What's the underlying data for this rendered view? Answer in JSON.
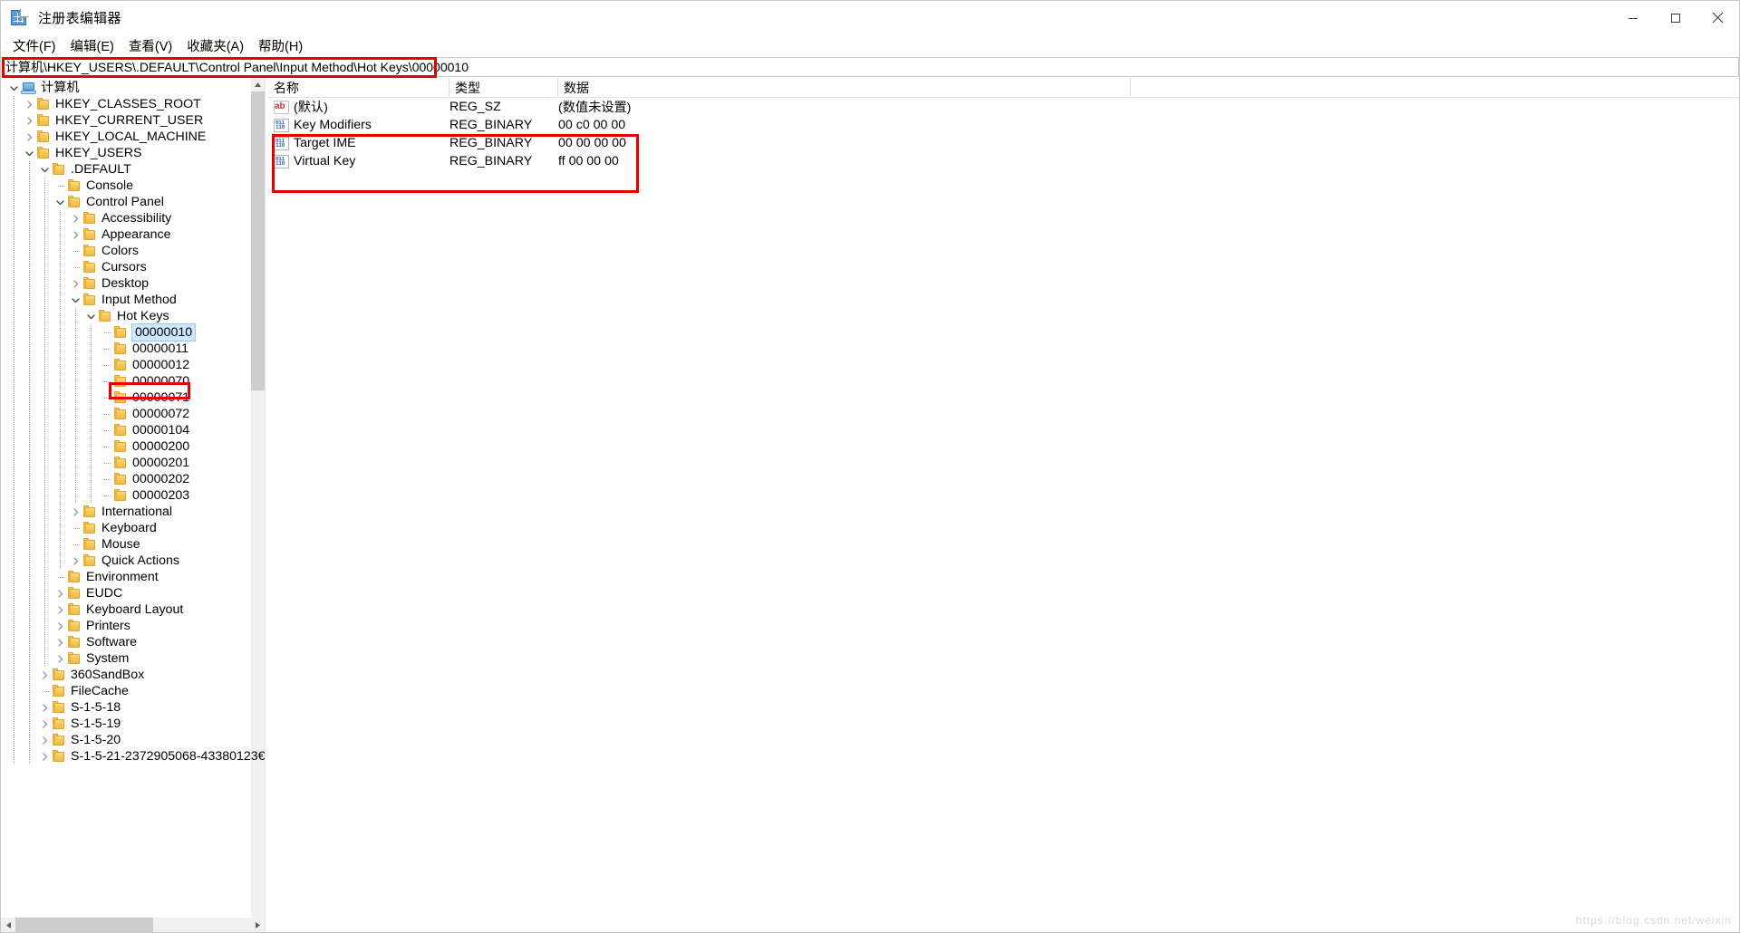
{
  "window": {
    "title": "注册表编辑器",
    "icon": "registry-editor-icon",
    "minimize_label": "最小化",
    "maximize_label": "最大化",
    "close_label": "关闭"
  },
  "menu": {
    "items": [
      {
        "label": "文件(F)",
        "name": "file"
      },
      {
        "label": "编辑(E)",
        "name": "edit"
      },
      {
        "label": "查看(V)",
        "name": "view"
      },
      {
        "label": "收藏夹(A)",
        "name": "favorites"
      },
      {
        "label": "帮助(H)",
        "name": "help"
      }
    ]
  },
  "address": {
    "value": "计算机\\HKEY_USERS\\.DEFAULT\\Control Panel\\Input Method\\Hot Keys\\00000010",
    "placeholder": ""
  },
  "tree": {
    "nodes": [
      {
        "label": "计算机",
        "depth": 0,
        "twist": "expanded",
        "icon": "computer",
        "selected": false
      },
      {
        "label": "HKEY_CLASSES_ROOT",
        "depth": 1,
        "twist": "collapsed",
        "icon": "folder",
        "selected": false
      },
      {
        "label": "HKEY_CURRENT_USER",
        "depth": 1,
        "twist": "collapsed",
        "icon": "folder",
        "selected": false
      },
      {
        "label": "HKEY_LOCAL_MACHINE",
        "depth": 1,
        "twist": "collapsed",
        "icon": "folder",
        "selected": false
      },
      {
        "label": "HKEY_USERS",
        "depth": 1,
        "twist": "expanded",
        "icon": "folder",
        "selected": false
      },
      {
        "label": ".DEFAULT",
        "depth": 2,
        "twist": "expanded",
        "icon": "folder",
        "selected": false
      },
      {
        "label": "Console",
        "depth": 3,
        "twist": "leaf",
        "icon": "folder",
        "selected": false
      },
      {
        "label": "Control Panel",
        "depth": 3,
        "twist": "expanded",
        "icon": "folder",
        "selected": false
      },
      {
        "label": "Accessibility",
        "depth": 4,
        "twist": "collapsed",
        "icon": "folder",
        "selected": false
      },
      {
        "label": "Appearance",
        "depth": 4,
        "twist": "collapsed",
        "icon": "folder",
        "selected": false
      },
      {
        "label": "Colors",
        "depth": 4,
        "twist": "leaf",
        "icon": "folder",
        "selected": false
      },
      {
        "label": "Cursors",
        "depth": 4,
        "twist": "leaf",
        "icon": "folder",
        "selected": false
      },
      {
        "label": "Desktop",
        "depth": 4,
        "twist": "collapsed",
        "icon": "folder",
        "selected": false
      },
      {
        "label": "Input Method",
        "depth": 4,
        "twist": "expanded",
        "icon": "folder",
        "selected": false
      },
      {
        "label": "Hot Keys",
        "depth": 5,
        "twist": "expanded",
        "icon": "folder",
        "selected": false
      },
      {
        "label": "00000010",
        "depth": 6,
        "twist": "leaf",
        "icon": "folder",
        "selected": true
      },
      {
        "label": "00000011",
        "depth": 6,
        "twist": "leaf",
        "icon": "folder",
        "selected": false
      },
      {
        "label": "00000012",
        "depth": 6,
        "twist": "leaf",
        "icon": "folder",
        "selected": false
      },
      {
        "label": "00000070",
        "depth": 6,
        "twist": "leaf",
        "icon": "folder",
        "selected": false
      },
      {
        "label": "00000071",
        "depth": 6,
        "twist": "leaf",
        "icon": "folder",
        "selected": false
      },
      {
        "label": "00000072",
        "depth": 6,
        "twist": "leaf",
        "icon": "folder",
        "selected": false
      },
      {
        "label": "00000104",
        "depth": 6,
        "twist": "leaf",
        "icon": "folder",
        "selected": false
      },
      {
        "label": "00000200",
        "depth": 6,
        "twist": "leaf",
        "icon": "folder",
        "selected": false
      },
      {
        "label": "00000201",
        "depth": 6,
        "twist": "leaf",
        "icon": "folder",
        "selected": false
      },
      {
        "label": "00000202",
        "depth": 6,
        "twist": "leaf",
        "icon": "folder",
        "selected": false
      },
      {
        "label": "00000203",
        "depth": 6,
        "twist": "leaf",
        "icon": "folder",
        "selected": false
      },
      {
        "label": "International",
        "depth": 4,
        "twist": "collapsed",
        "icon": "folder",
        "selected": false
      },
      {
        "label": "Keyboard",
        "depth": 4,
        "twist": "leaf",
        "icon": "folder",
        "selected": false
      },
      {
        "label": "Mouse",
        "depth": 4,
        "twist": "leaf",
        "icon": "folder",
        "selected": false
      },
      {
        "label": "Quick Actions",
        "depth": 4,
        "twist": "collapsed",
        "icon": "folder",
        "selected": false
      },
      {
        "label": "Environment",
        "depth": 3,
        "twist": "leaf",
        "icon": "folder",
        "selected": false
      },
      {
        "label": "EUDC",
        "depth": 3,
        "twist": "collapsed",
        "icon": "folder",
        "selected": false
      },
      {
        "label": "Keyboard Layout",
        "depth": 3,
        "twist": "collapsed",
        "icon": "folder",
        "selected": false
      },
      {
        "label": "Printers",
        "depth": 3,
        "twist": "collapsed",
        "icon": "folder",
        "selected": false
      },
      {
        "label": "Software",
        "depth": 3,
        "twist": "collapsed",
        "icon": "folder",
        "selected": false
      },
      {
        "label": "System",
        "depth": 3,
        "twist": "collapsed",
        "icon": "folder",
        "selected": false
      },
      {
        "label": "360SandBox",
        "depth": 2,
        "twist": "collapsed",
        "icon": "folder",
        "selected": false
      },
      {
        "label": "FileCache",
        "depth": 2,
        "twist": "leaf",
        "icon": "folder",
        "selected": false
      },
      {
        "label": "S-1-5-18",
        "depth": 2,
        "twist": "collapsed",
        "icon": "folder",
        "selected": false
      },
      {
        "label": "S-1-5-19",
        "depth": 2,
        "twist": "collapsed",
        "icon": "folder",
        "selected": false
      },
      {
        "label": "S-1-5-20",
        "depth": 2,
        "twist": "collapsed",
        "icon": "folder",
        "selected": false
      },
      {
        "label": "S-1-5-21-2372905068-43380123€",
        "depth": 2,
        "twist": "collapsed",
        "icon": "folder",
        "selected": false
      }
    ]
  },
  "list": {
    "columns": [
      "名称",
      "类型",
      "数据",
      ""
    ],
    "rows": [
      {
        "name": "(默认)",
        "type": "REG_SZ",
        "data": "(数值未设置)",
        "icon": "string-value-icon"
      },
      {
        "name": "Key Modifiers",
        "type": "REG_BINARY",
        "data": "00 c0 00 00",
        "icon": "binary-value-icon"
      },
      {
        "name": "Target IME",
        "type": "REG_BINARY",
        "data": "00 00 00 00",
        "icon": "binary-value-icon"
      },
      {
        "name": "Virtual Key",
        "type": "REG_BINARY",
        "data": "ff 00 00 00",
        "icon": "binary-value-icon"
      }
    ]
  },
  "annotations": {
    "color": "#e60000"
  },
  "watermark": {
    "text": "https://blog.csdn.net/weixin"
  }
}
